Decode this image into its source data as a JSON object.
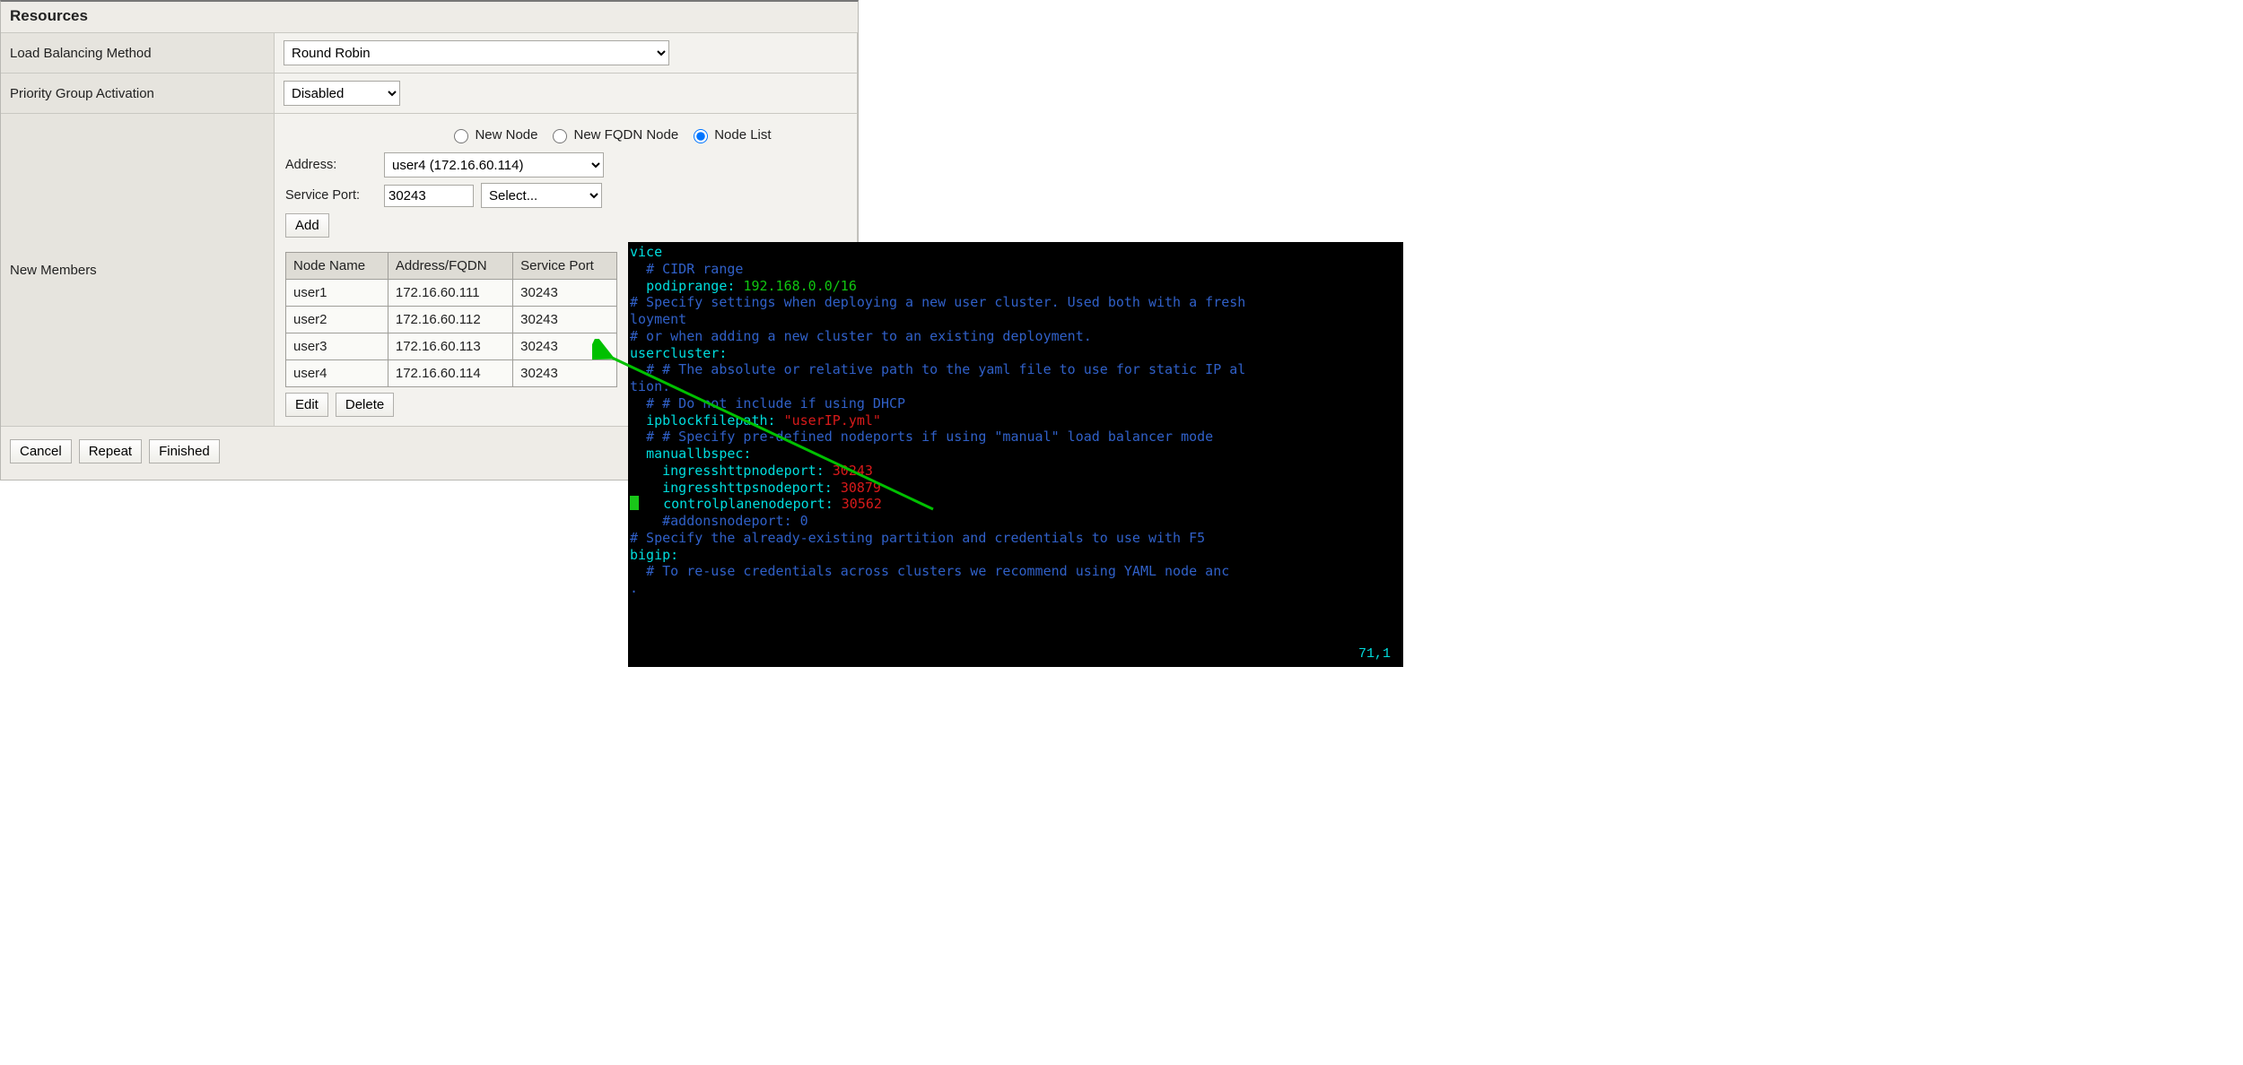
{
  "panel": {
    "title": "Resources",
    "rows": {
      "lb_method": {
        "label": "Load Balancing Method",
        "value": "Round Robin"
      },
      "pg_act": {
        "label": "Priority Group Activation",
        "value": "Disabled"
      },
      "members": {
        "label": "New Members"
      }
    },
    "node_source": {
      "new_node": "New Node",
      "new_fqdn": "New FQDN Node",
      "node_list": "Node List",
      "selected": "node_list"
    },
    "address": {
      "label": "Address:",
      "value": "user4 (172.16.60.114)"
    },
    "service_port": {
      "label": "Service Port:",
      "port": "30243",
      "proto": "Select..."
    },
    "add_label": "Add",
    "table": {
      "headers": [
        "Node Name",
        "Address/FQDN",
        "Service Port"
      ],
      "rows": [
        {
          "name": "user1",
          "addr": "172.16.60.111",
          "port": "30243"
        },
        {
          "name": "user2",
          "addr": "172.16.60.112",
          "port": "30243"
        },
        {
          "name": "user3",
          "addr": "172.16.60.113",
          "port": "30243"
        },
        {
          "name": "user4",
          "addr": "172.16.60.114",
          "port": "30243"
        }
      ],
      "edit": "Edit",
      "delete": "Delete"
    },
    "footer": {
      "cancel": "Cancel",
      "repeat": "Repeat",
      "finished": "Finished"
    }
  },
  "terminal": {
    "frag_vice": "vice",
    "cidr_comment": "# CIDR range",
    "podip_key": "podiprange:",
    "podip_val": "192.168.0.0/16",
    "uc_header": "# Specify settings when deploying a new user cluster. Used both with a fresh",
    "loyment": "loyment",
    "uc_or": "# or when adding a new cluster to an existing deployment.",
    "uc_key": "usercluster:",
    "uc_path_c": "# # The absolute or relative path to the yaml file to use for static IP al",
    "tion": "tion.",
    "dhcp_c": "# # Do not include if using DHCP",
    "ipblock_key": "ipblockfilepath:",
    "ipblock_val": "\"userIP.yml\"",
    "mlb_c": "# # Specify pre-defined nodeports if using \"manual\" load balancer mode",
    "mlb_key": "manuallbspec:",
    "ihttp_key": "ingresshttpnodeport:",
    "ihttp_val": "30243",
    "ihttps_key": "ingresshttpsnodeport:",
    "ihttps_val": "30879",
    "cplane_key": "controlplanenodeport:",
    "cplane_val": "30562",
    "addons_c": "#addonsnodeport: 0",
    "f5_c": "# Specify the already-existing partition and credentials to use with F5",
    "bigip_key": "bigip:",
    "reuse_c": "# To re-use credentials across clusters we recommend using YAML node anc",
    "dot": ".",
    "cursor_pos": "71,1"
  }
}
